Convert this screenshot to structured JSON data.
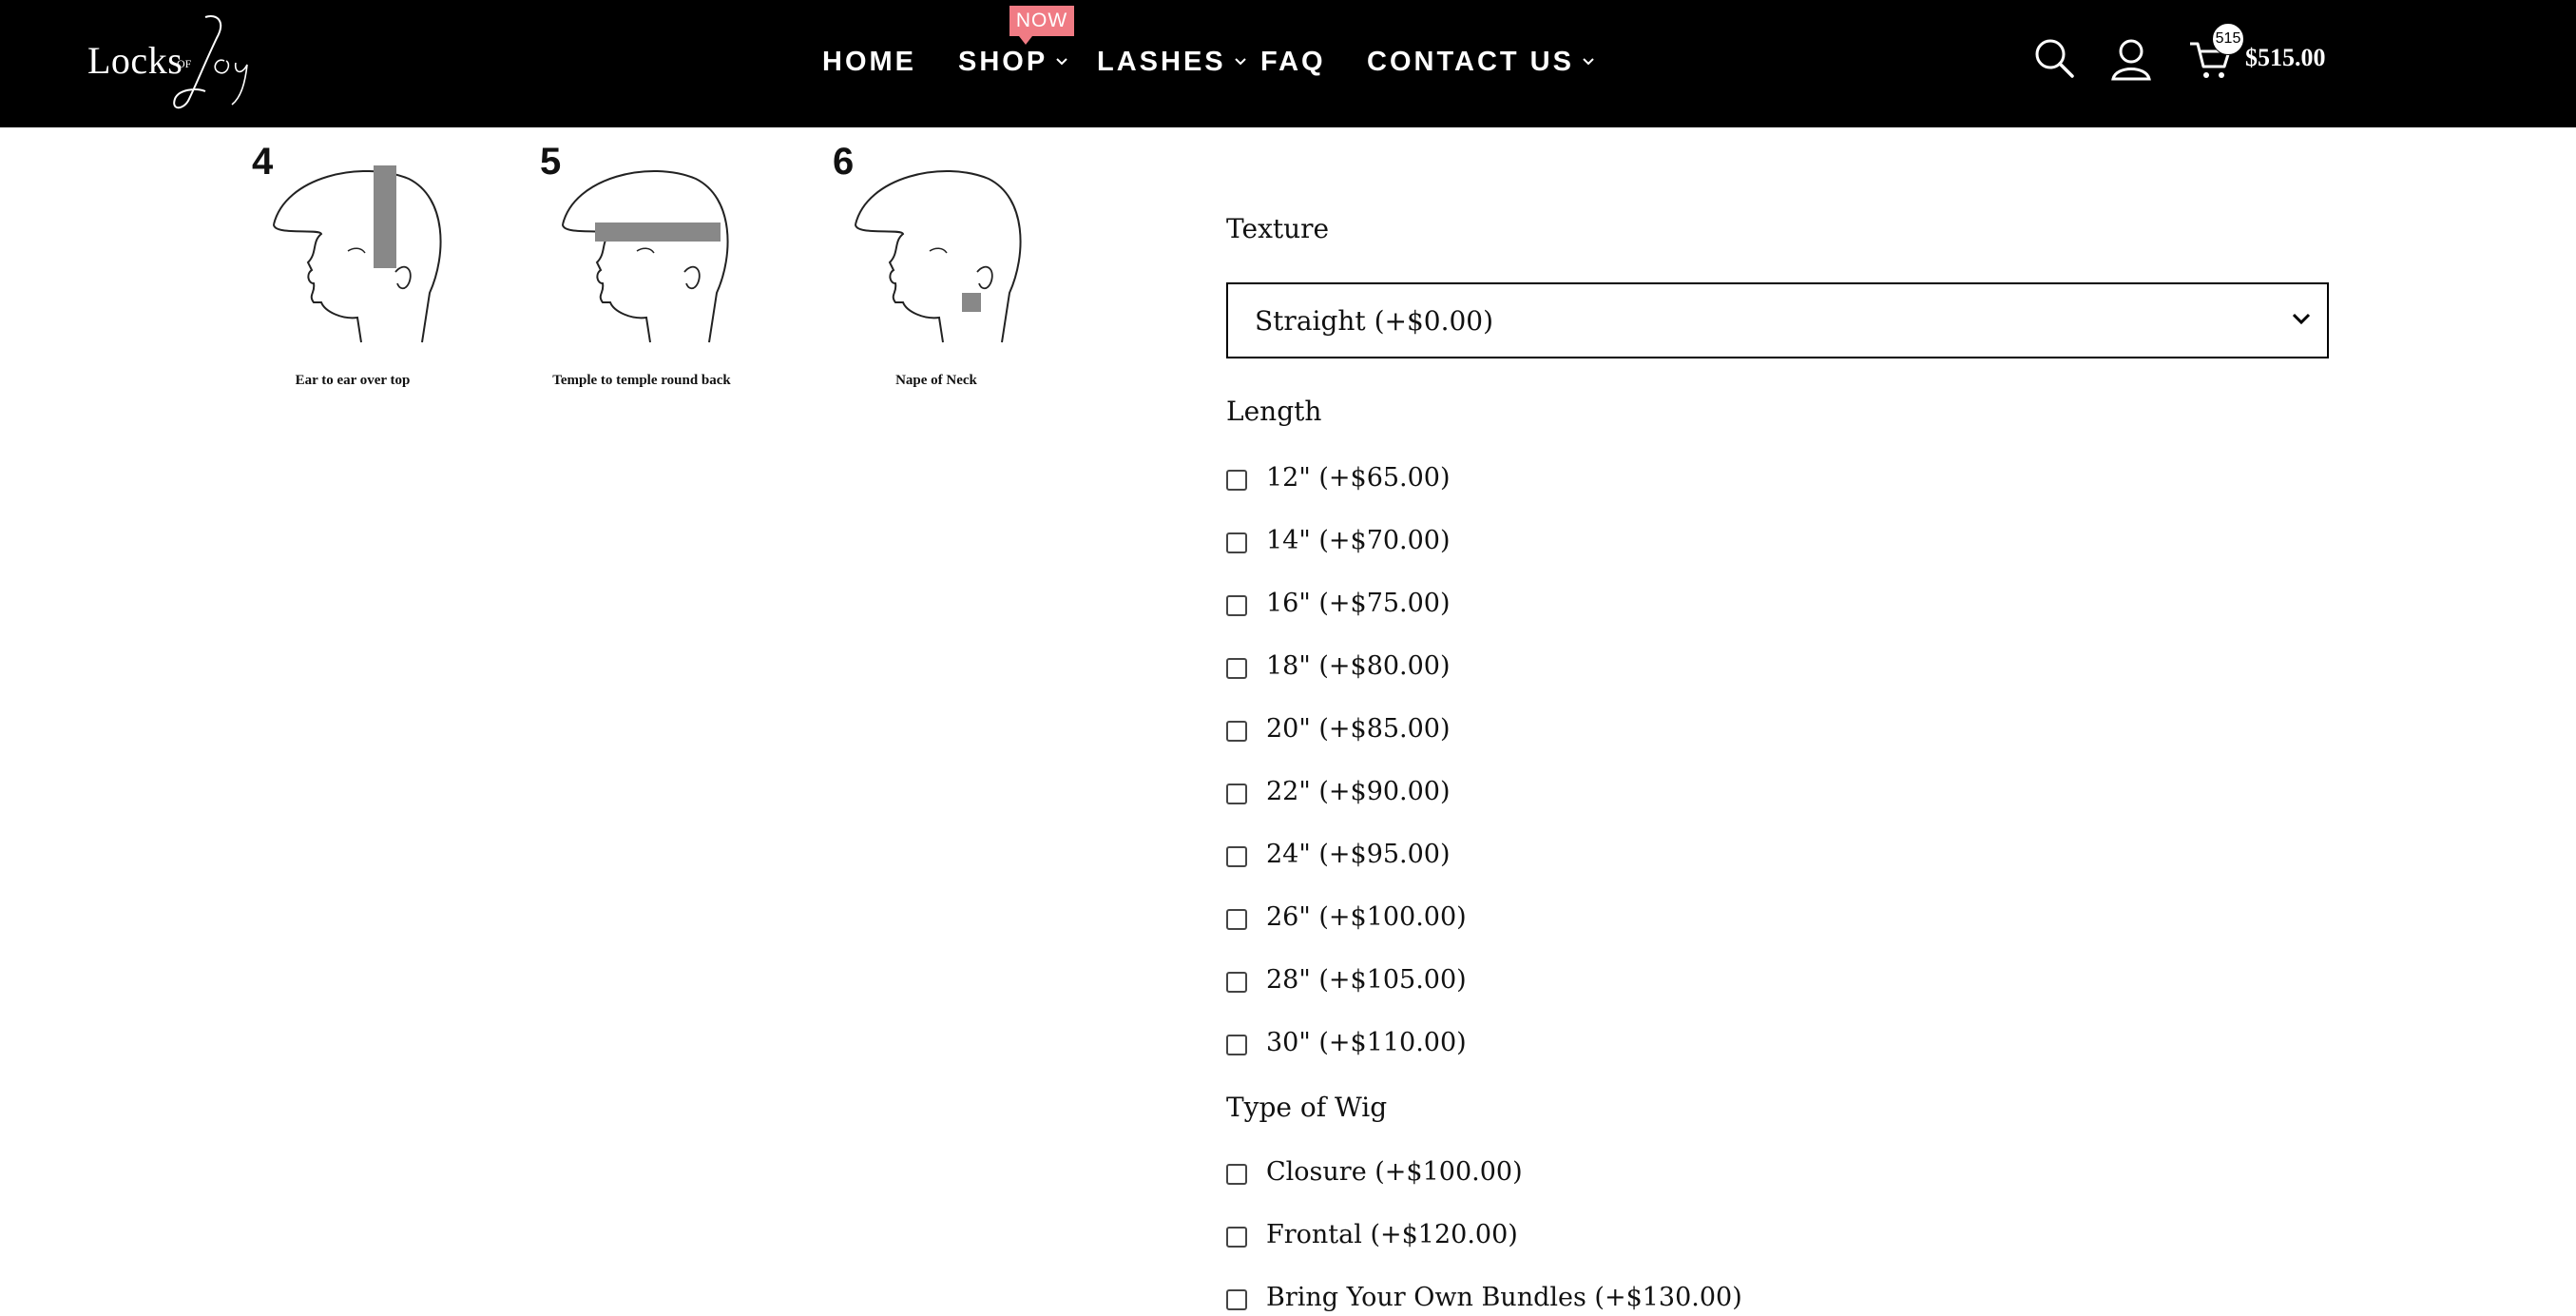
{
  "brand": {
    "logo_primary": "Locks",
    "logo_connector": "OF",
    "logo_script": "Joy"
  },
  "nav": {
    "items": [
      {
        "label": "HOME",
        "dropdown": false
      },
      {
        "label": "SHOP",
        "dropdown": true,
        "badge": "NOW"
      },
      {
        "label": "LASHES",
        "dropdown": true
      },
      {
        "label": "FAQ",
        "dropdown": false
      },
      {
        "label": "CONTACT US",
        "dropdown": true
      }
    ]
  },
  "header_icons": {
    "search": "search-icon",
    "account": "user-icon",
    "cart": "cart-icon",
    "cart_count": "515",
    "cart_total": "$515.00"
  },
  "diagrams": [
    {
      "number": "4",
      "caption": "Ear to ear over top"
    },
    {
      "number": "5",
      "caption": "Temple to temple round back"
    },
    {
      "number": "6",
      "caption": "Nape of Neck"
    }
  ],
  "form": {
    "texture": {
      "label": "Texture",
      "selected": "Straight (+$0.00)"
    },
    "length": {
      "label": "Length",
      "options": [
        "12\" (+$65.00)",
        "14\" (+$70.00)",
        "16\" (+$75.00)",
        "18\" (+$80.00)",
        "20\" (+$85.00)",
        "22\" (+$90.00)",
        "24\" (+$95.00)",
        "26\" (+$100.00)",
        "28\" (+$105.00)",
        "30\" (+$110.00)"
      ]
    },
    "wig_type": {
      "label": "Type of Wig",
      "options": [
        "Closure (+$100.00)",
        "Frontal (+$120.00)",
        "Bring Your Own Bundles (+$130.00)"
      ]
    }
  },
  "colors": {
    "header_bg": "#000000",
    "badge": "#f07b84",
    "text": "#111111"
  }
}
